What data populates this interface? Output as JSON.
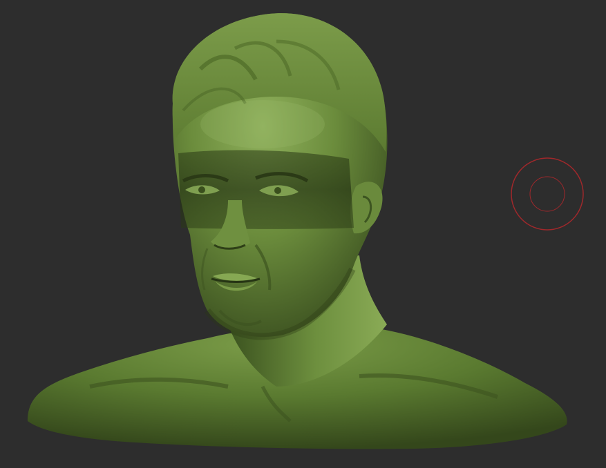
{
  "viewport": {
    "background_color": "#2d2d2d"
  },
  "model": {
    "subject": "male-bust-sculpt",
    "base_color": "#5f7d36",
    "highlight_color": "#8fb05c",
    "shadow_color": "#2f4018"
  },
  "brush_cursor": {
    "icon": "brush-circle-icon",
    "color": "#a0282b"
  }
}
